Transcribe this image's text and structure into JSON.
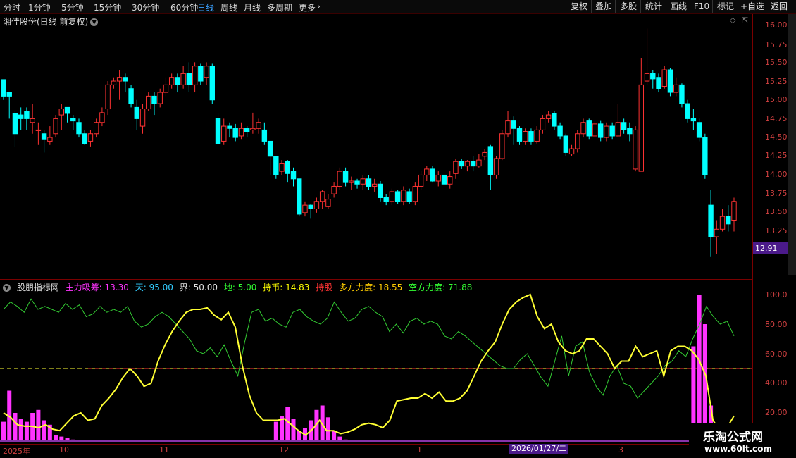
{
  "toolbar": {
    "periods": [
      "分时",
      "1分钟",
      "5分钟",
      "15分钟",
      "30分钟",
      "60分钟",
      "日线",
      "周线",
      "月线",
      "多周期",
      "更多"
    ],
    "active_period": "日线",
    "buttons": [
      "复权",
      "叠加",
      "多股",
      "统计",
      "画线",
      "F10",
      "标记",
      "+自选",
      "返回"
    ]
  },
  "stock_title": "湘佳股份(日线 前复权)",
  "price_axis": [
    "16.00",
    "15.75",
    "15.50",
    "15.25",
    "15.00",
    "14.75",
    "14.50",
    "14.25",
    "14.00",
    "13.75",
    "13.50",
    "13.25"
  ],
  "current_price": "12.91",
  "indicator": {
    "name": "股朋指标网",
    "items": [
      {
        "label": "主力吸筹: 13.30",
        "color": "#ff33ff"
      },
      {
        "label": "天: 95.00",
        "color": "#33ccff"
      },
      {
        "label": "界: 50.00",
        "color": "#e0e0e0"
      },
      {
        "label": "地: 5.00",
        "color": "#33ff33"
      },
      {
        "label": "持币: 14.83",
        "color": "#ffff00"
      },
      {
        "label": "持股",
        "color": "#ff3333"
      },
      {
        "label": "多方力度: 18.55",
        "color": "#ffcc00"
      },
      {
        "label": "空方力度: 71.88",
        "color": "#33ff33"
      }
    ],
    "axis": [
      "100.0",
      "80.00",
      "60.00",
      "40.00",
      "20.00"
    ]
  },
  "date_axis": [
    "2025年",
    "10",
    "11",
    "12",
    "1",
    "3"
  ],
  "selected_date": "2026/01/27/二",
  "watermark": {
    "title": "乐淘公式网",
    "url": "www.60lt.com"
  },
  "colors": {
    "up": "#ff3232",
    "down": "#00ffff",
    "yellow_line": "#ffff33",
    "green_line": "#33cc33",
    "bar": "#ff33ff"
  },
  "chart_data": {
    "type": "candlestick",
    "ohlc": [
      [
        15.27,
        15.05,
        15.25,
        15.0
      ],
      [
        15.1,
        15.05,
        15.1,
        14.75
      ],
      [
        14.82,
        14.55,
        14.85,
        14.37
      ],
      [
        14.8,
        14.75,
        14.9,
        14.6
      ],
      [
        14.85,
        14.75,
        14.9,
        14.6
      ],
      [
        14.7,
        14.75,
        14.95,
        14.55
      ],
      [
        14.6,
        14.6,
        14.7,
        14.4
      ],
      [
        14.55,
        14.48,
        14.6,
        14.3
      ],
      [
        14.45,
        14.5,
        14.65,
        14.4
      ],
      [
        14.55,
        14.75,
        14.8,
        14.5
      ],
      [
        14.8,
        14.88,
        14.95,
        14.6
      ],
      [
        14.9,
        14.82,
        14.9,
        14.7
      ],
      [
        14.75,
        14.72,
        14.8,
        14.6
      ],
      [
        14.7,
        14.55,
        14.75,
        14.5
      ],
      [
        14.55,
        14.42,
        14.6,
        14.4
      ],
      [
        14.45,
        14.55,
        14.6,
        14.38
      ],
      [
        14.55,
        14.7,
        14.75,
        14.5
      ],
      [
        14.7,
        14.83,
        14.9,
        14.65
      ],
      [
        14.88,
        15.2,
        15.25,
        14.8
      ],
      [
        15.2,
        15.25,
        15.3,
        15.15
      ],
      [
        15.25,
        15.3,
        15.4,
        15.0
      ],
      [
        15.3,
        15.25,
        15.35,
        15.1
      ],
      [
        15.15,
        14.95,
        15.2,
        14.9
      ],
      [
        14.9,
        14.75,
        15.0,
        14.6
      ],
      [
        14.65,
        14.88,
        14.95,
        14.55
      ],
      [
        14.88,
        15.05,
        15.1,
        14.85
      ],
      [
        15.05,
        14.95,
        15.1,
        14.8
      ],
      [
        14.95,
        15.1,
        15.15,
        14.9
      ],
      [
        15.1,
        15.2,
        15.3,
        15.05
      ],
      [
        15.2,
        15.3,
        15.35,
        15.15
      ],
      [
        15.3,
        15.2,
        15.35,
        15.1
      ],
      [
        15.2,
        15.35,
        15.45,
        15.15
      ],
      [
        15.35,
        15.2,
        15.5,
        15.1
      ],
      [
        15.2,
        15.45,
        15.5,
        15.1
      ],
      [
        15.45,
        15.25,
        15.48,
        15.2
      ],
      [
        15.3,
        15.45,
        15.5,
        15.2
      ],
      [
        15.45,
        15.0,
        15.48,
        14.95
      ],
      [
        14.75,
        14.42,
        14.82,
        14.4
      ],
      [
        14.45,
        14.65,
        14.75,
        14.4
      ],
      [
        14.65,
        14.62,
        14.7,
        14.5
      ],
      [
        14.62,
        14.5,
        14.68,
        14.45
      ],
      [
        14.52,
        14.62,
        14.7,
        14.48
      ],
      [
        14.62,
        14.58,
        14.65,
        14.5
      ],
      [
        14.6,
        14.62,
        14.83,
        14.55
      ],
      [
        14.62,
        14.7,
        14.75,
        14.55
      ],
      [
        14.6,
        14.45,
        14.7,
        14.4
      ],
      [
        14.45,
        14.25,
        14.45,
        14.0
      ],
      [
        14.25,
        14.0,
        14.25,
        13.95
      ],
      [
        14.05,
        14.15,
        14.2,
        14.0
      ],
      [
        14.18,
        14.02,
        14.2,
        13.9
      ],
      [
        14.05,
        13.95,
        14.1,
        13.85
      ],
      [
        13.95,
        13.48,
        13.95,
        13.45
      ],
      [
        13.5,
        13.6,
        13.65,
        13.45
      ],
      [
        13.6,
        13.55,
        13.62,
        13.42
      ],
      [
        13.55,
        13.65,
        13.7,
        13.5
      ],
      [
        13.65,
        13.78,
        13.8,
        13.55
      ],
      [
        13.58,
        13.68,
        13.75,
        13.55
      ],
      [
        13.75,
        13.85,
        13.9,
        13.7
      ],
      [
        13.85,
        14.05,
        14.1,
        13.8
      ],
      [
        14.05,
        13.9,
        14.1,
        13.85
      ],
      [
        13.9,
        13.92,
        13.98,
        13.8
      ],
      [
        13.92,
        13.88,
        13.95,
        13.82
      ],
      [
        13.88,
        13.95,
        14.0,
        13.8
      ],
      [
        13.95,
        13.85,
        14.0,
        13.8
      ],
      [
        13.85,
        13.88,
        13.95,
        13.78
      ],
      [
        13.88,
        13.7,
        13.92,
        13.65
      ],
      [
        13.7,
        13.65,
        13.75,
        13.6
      ],
      [
        13.65,
        13.78,
        13.82,
        13.6
      ],
      [
        13.78,
        13.65,
        13.8,
        13.62
      ],
      [
        13.65,
        13.8,
        13.85,
        13.6
      ],
      [
        13.78,
        13.65,
        13.82,
        13.62
      ],
      [
        13.65,
        13.85,
        13.9,
        13.6
      ],
      [
        13.85,
        14.0,
        14.05,
        13.8
      ],
      [
        14.0,
        14.08,
        14.12,
        13.92
      ],
      [
        14.08,
        13.92,
        14.12,
        13.9
      ],
      [
        13.92,
        14.0,
        14.05,
        13.85
      ],
      [
        14.0,
        13.88,
        14.05,
        13.8
      ],
      [
        13.88,
        13.98,
        14.05,
        13.82
      ],
      [
        14.02,
        14.18,
        14.22,
        13.95
      ],
      [
        14.18,
        14.12,
        14.22,
        14.08
      ],
      [
        14.12,
        14.18,
        14.2,
        14.05
      ],
      [
        14.18,
        14.12,
        14.25,
        14.05
      ],
      [
        14.12,
        14.2,
        14.28,
        14.1
      ],
      [
        14.25,
        14.3,
        14.35,
        14.2
      ],
      [
        14.38,
        14.0,
        14.4,
        13.8
      ],
      [
        14.0,
        14.22,
        14.25,
        13.95
      ],
      [
        14.22,
        14.55,
        14.6,
        14.2
      ],
      [
        14.55,
        14.72,
        14.85,
        14.5
      ],
      [
        14.72,
        14.62,
        14.78,
        14.4
      ],
      [
        14.62,
        14.45,
        14.65,
        14.4
      ],
      [
        14.45,
        14.58,
        14.62,
        14.4
      ],
      [
        14.58,
        14.45,
        14.62,
        14.4
      ],
      [
        14.45,
        14.6,
        14.65,
        14.42
      ],
      [
        14.6,
        14.75,
        14.8,
        14.55
      ],
      [
        14.75,
        14.8,
        14.85,
        14.7
      ],
      [
        14.82,
        14.65,
        14.85,
        14.6
      ],
      [
        14.65,
        14.52,
        14.7,
        14.48
      ],
      [
        14.52,
        14.3,
        14.55,
        14.25
      ],
      [
        14.28,
        14.35,
        14.4,
        14.25
      ],
      [
        14.35,
        14.55,
        14.6,
        14.3
      ],
      [
        14.55,
        14.7,
        14.75,
        14.5
      ],
      [
        14.72,
        14.52,
        14.75,
        14.48
      ],
      [
        14.52,
        14.68,
        14.72,
        14.5
      ],
      [
        14.68,
        14.5,
        14.72,
        14.45
      ],
      [
        14.5,
        14.65,
        14.7,
        14.45
      ],
      [
        14.65,
        14.52,
        14.7,
        14.48
      ],
      [
        14.52,
        14.7,
        14.95,
        14.5
      ],
      [
        14.7,
        14.6,
        14.75,
        14.55
      ],
      [
        14.62,
        14.55,
        14.7,
        14.45
      ],
      [
        14.08,
        14.6,
        14.65,
        14.05
      ],
      [
        14.05,
        15.2,
        15.55,
        14.05
      ],
      [
        15.25,
        15.35,
        15.95,
        15.2
      ],
      [
        15.35,
        15.28,
        15.4,
        15.15
      ],
      [
        15.3,
        15.15,
        15.35,
        15.1
      ],
      [
        15.18,
        15.4,
        15.45,
        15.15
      ],
      [
        15.4,
        15.1,
        15.42,
        15.05
      ],
      [
        15.1,
        15.2,
        15.3,
        15.05
      ],
      [
        15.2,
        14.95,
        15.22,
        14.9
      ],
      [
        14.95,
        14.75,
        15.0,
        14.7
      ],
      [
        14.75,
        14.72,
        14.88,
        14.6
      ],
      [
        14.7,
        14.5,
        14.75,
        14.45
      ],
      [
        14.5,
        14.0,
        14.55,
        13.95
      ],
      [
        13.6,
        13.18,
        13.8,
        12.91
      ],
      [
        13.18,
        13.28,
        13.4,
        12.95
      ],
      [
        13.28,
        13.45,
        13.55,
        13.25
      ],
      [
        13.45,
        13.35,
        13.6,
        13.25
      ],
      [
        13.4,
        13.65,
        13.7,
        13.25
      ]
    ],
    "indicator_series": [
      {
        "name": "多方力度",
        "color": "#ffff33",
        "values": [
          20,
          17,
          12,
          11,
          11,
          10,
          12,
          9,
          8,
          13,
          18,
          20,
          15,
          16,
          25,
          30,
          36,
          44,
          50,
          45,
          38,
          40,
          55,
          66,
          75,
          82,
          88,
          90,
          90,
          91,
          86,
          83,
          88,
          78,
          52,
          32,
          20,
          15,
          15,
          15,
          16,
          12,
          8,
          5,
          9,
          15,
          8,
          8,
          6,
          7,
          9,
          12,
          13,
          12,
          10,
          15,
          28,
          29,
          30,
          30,
          33,
          30,
          34,
          28,
          28,
          30,
          35,
          45,
          55,
          62,
          68,
          80,
          90,
          95,
          98,
          100,
          85,
          77,
          80,
          68,
          62,
          60,
          62,
          70,
          70,
          65,
          60,
          50,
          55,
          55,
          65,
          58,
          60,
          62,
          45,
          62,
          65,
          65,
          62,
          56,
          45,
          15,
          8,
          10,
          18
        ]
      },
      {
        "name": "空方力度",
        "color": "#33cc33",
        "values": [
          90,
          95,
          92,
          88,
          97,
          90,
          92,
          90,
          88,
          94,
          90,
          93,
          85,
          87,
          92,
          88,
          90,
          88,
          92,
          82,
          78,
          80,
          85,
          88,
          85,
          80,
          75,
          70,
          62,
          60,
          64,
          58,
          66,
          55,
          45,
          68,
          88,
          90,
          82,
          84,
          80,
          78,
          88,
          90,
          85,
          82,
          80,
          84,
          95,
          88,
          82,
          84,
          90,
          92,
          88,
          85,
          75,
          80,
          74,
          82,
          84,
          80,
          82,
          80,
          72,
          70,
          75,
          72,
          68,
          64,
          60,
          56,
          52,
          50,
          50,
          56,
          60,
          52,
          44,
          38,
          55,
          72,
          45,
          65,
          68,
          48,
          38,
          32,
          45,
          52,
          40,
          38,
          30,
          35,
          40,
          45,
          52,
          55,
          62,
          58,
          70,
          80,
          92,
          85,
          80,
          82,
          72
        ]
      },
      {
        "name": "主力吸筹",
        "color": "#ff33ff",
        "values": [
          14,
          35,
          20,
          16,
          14,
          20,
          22,
          15,
          12,
          5,
          4,
          3,
          2,
          1,
          1,
          0,
          0,
          0,
          0,
          0,
          0,
          0,
          0,
          0,
          0,
          0,
          0,
          0,
          0,
          0,
          0,
          0,
          0,
          0,
          0,
          0,
          0,
          0,
          0,
          0,
          0,
          0,
          0,
          0,
          0,
          0,
          0,
          14,
          18,
          24,
          16,
          8,
          10,
          15,
          22,
          25,
          17,
          8,
          4,
          2,
          1,
          1,
          0,
          0,
          0,
          0,
          0,
          0,
          0,
          0,
          0,
          0,
          0,
          0,
          0,
          0,
          0,
          0,
          0,
          0,
          0,
          0,
          0,
          0,
          0,
          0,
          0,
          0,
          0,
          0,
          0,
          0,
          0,
          0,
          0,
          0,
          0,
          0,
          0,
          0,
          0,
          0,
          0,
          0,
          0,
          0,
          0,
          0,
          0,
          0,
          0,
          0,
          0,
          0,
          0,
          0,
          0,
          0,
          0,
          65,
          100,
          80,
          25,
          13
        ]
      },
      {
        "name": "天",
        "color": "#33ccff",
        "values": [
          95
        ]
      },
      {
        "name": "界",
        "color": "#e0e0e0",
        "values": [
          50
        ]
      },
      {
        "name": "地",
        "color": "#33ff33",
        "values": [
          5
        ]
      }
    ]
  }
}
